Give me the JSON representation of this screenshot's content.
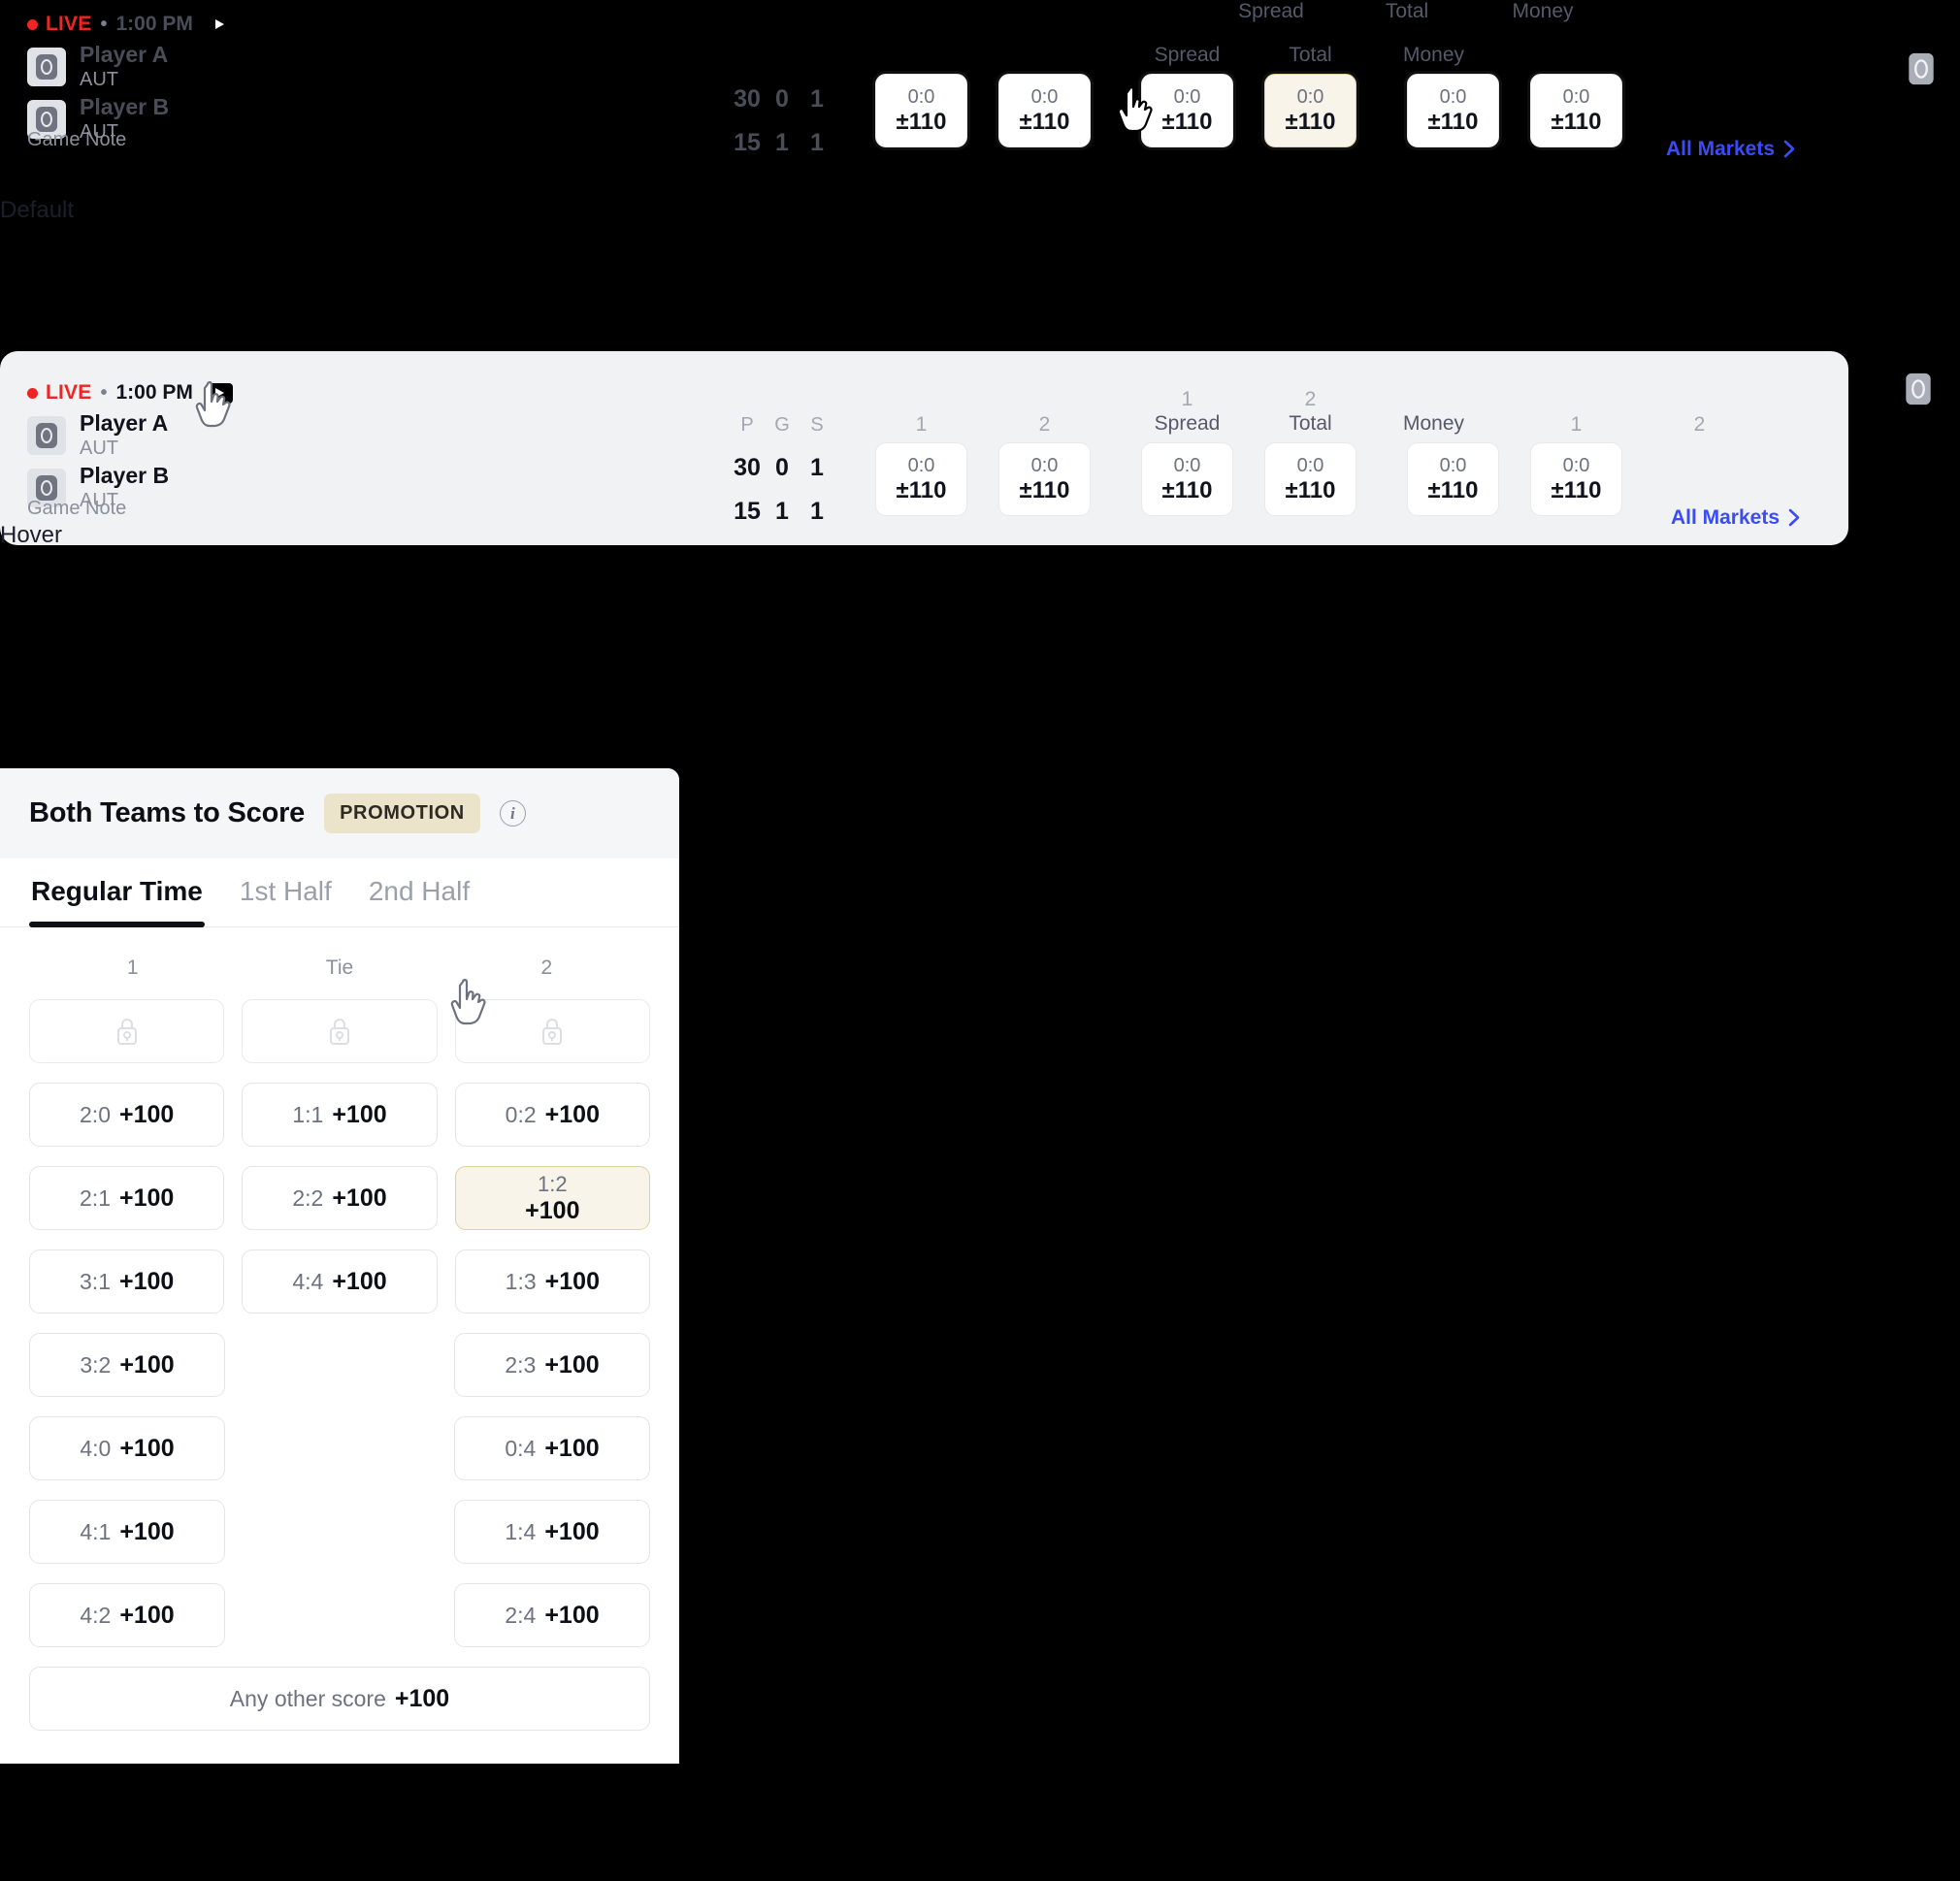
{
  "section_labels": {
    "default": "Default",
    "hover": "Hover"
  },
  "event": {
    "live_label": "LIVE",
    "separator": "•",
    "start_time": "1:00 PM",
    "play_icon": "play-icon",
    "teams": [
      {
        "name": "Player A",
        "abbr": "AUT"
      },
      {
        "name": "Player B",
        "abbr": "AUT"
      }
    ],
    "game_note": "Game Note",
    "all_markets": "All Markets",
    "stat_headers": [
      "P",
      "G",
      "S"
    ],
    "stat_rows": [
      [
        "30",
        "0",
        "1"
      ],
      [
        "15",
        "1",
        "1"
      ]
    ],
    "market_groups": [
      {
        "num": "1",
        "name": "",
        "score": "0:0",
        "price": "±110",
        "highlight": false
      },
      {
        "num": "2",
        "name": "",
        "score": "0:0",
        "price": "±110",
        "highlight": false
      },
      {
        "num": "1",
        "name": "Spread",
        "score": "0:0",
        "price": "±110",
        "highlight": false
      },
      {
        "num": "2",
        "name": "Total",
        "score": "0:0",
        "price": "±110",
        "highlight": false
      },
      {
        "num": "",
        "name": "Money",
        "score": "",
        "price": "",
        "highlight": false
      },
      {
        "num": "1",
        "name": "",
        "score": "0:0",
        "price": "±110",
        "highlight": false
      },
      {
        "num": "2",
        "name": "",
        "score": "0:0",
        "price": "±110",
        "highlight": false
      }
    ]
  },
  "market_panel": {
    "title": "Both Teams to Score",
    "promotion_badge": "PROMOTION",
    "info_icon": "info-icon",
    "info_glyph": "i",
    "tabs": [
      {
        "label": "Regular Time",
        "active": true
      },
      {
        "label": "1st Half",
        "active": false
      },
      {
        "label": "2nd Half",
        "active": false
      }
    ],
    "columns": [
      "1",
      "Tie",
      "2"
    ],
    "rows": [
      [
        {
          "type": "locked"
        },
        {
          "type": "locked"
        },
        {
          "type": "locked"
        }
      ],
      [
        {
          "type": "odds",
          "score": "2:0",
          "price": "+100"
        },
        {
          "type": "odds",
          "score": "1:1",
          "price": "+100"
        },
        {
          "type": "odds",
          "score": "0:2",
          "price": "+100"
        }
      ],
      [
        {
          "type": "odds",
          "score": "2:1",
          "price": "+100"
        },
        {
          "type": "odds",
          "score": "2:2",
          "price": "+100"
        },
        {
          "type": "odds",
          "score": "1:2",
          "price": "+100",
          "selected": true
        }
      ],
      [
        {
          "type": "odds",
          "score": "3:1",
          "price": "+100"
        },
        {
          "type": "odds",
          "score": "4:4",
          "price": "+100"
        },
        {
          "type": "odds",
          "score": "1:3",
          "price": "+100"
        }
      ],
      [
        {
          "type": "odds",
          "score": "3:2",
          "price": "+100"
        },
        {
          "type": "empty"
        },
        {
          "type": "odds",
          "score": "2:3",
          "price": "+100"
        }
      ],
      [
        {
          "type": "odds",
          "score": "4:0",
          "price": "+100"
        },
        {
          "type": "empty"
        },
        {
          "type": "odds",
          "score": "0:4",
          "price": "+100"
        }
      ],
      [
        {
          "type": "odds",
          "score": "4:1",
          "price": "+100"
        },
        {
          "type": "empty"
        },
        {
          "type": "odds",
          "score": "1:4",
          "price": "+100"
        }
      ],
      [
        {
          "type": "odds",
          "score": "4:2",
          "price": "+100"
        },
        {
          "type": "empty"
        },
        {
          "type": "odds",
          "score": "2:4",
          "price": "+100"
        }
      ]
    ],
    "any_other": {
      "score": "Any other score",
      "price": "+100"
    }
  },
  "colors": {
    "live_red": "#ef2424",
    "accent_blue": "#3a4cf5",
    "promo_bg": "#ece3cb",
    "selected_bg": "#f8f4e9",
    "selected_border": "#e3cfa4",
    "card_hover_bg": "#f1f2f4"
  }
}
